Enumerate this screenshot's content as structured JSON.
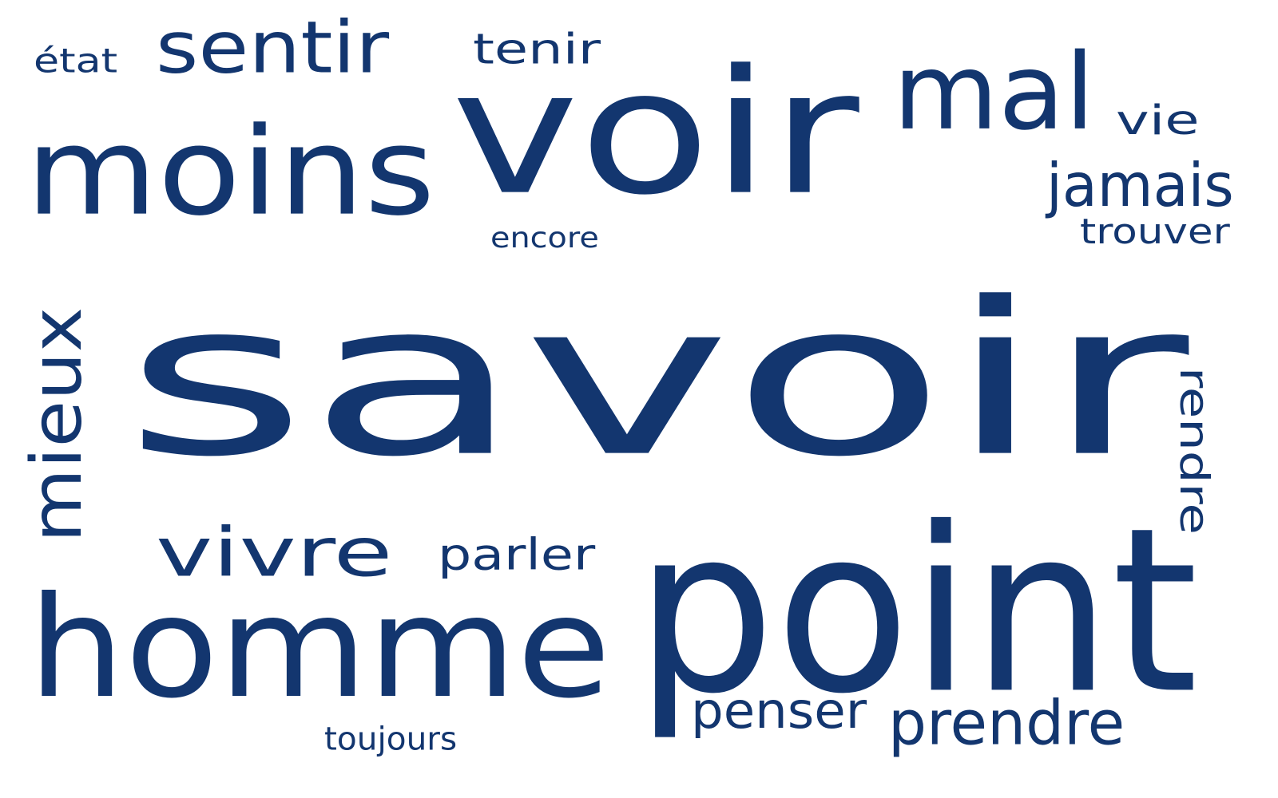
{
  "theme": {
    "background": "#ffffff",
    "word_color": "#13366f"
  },
  "words": [
    {
      "id": "savoir",
      "text": "savoir"
    },
    {
      "id": "point",
      "text": "point"
    },
    {
      "id": "voir",
      "text": "voir"
    },
    {
      "id": "homme",
      "text": "homme"
    },
    {
      "id": "moins",
      "text": "moins"
    },
    {
      "id": "mal",
      "text": "mal"
    },
    {
      "id": "mieux",
      "text": "mieux"
    },
    {
      "id": "vivre",
      "text": "vivre"
    },
    {
      "id": "sentir",
      "text": "sentir"
    },
    {
      "id": "rendre",
      "text": "rendre"
    },
    {
      "id": "prendre",
      "text": "prendre"
    },
    {
      "id": "penser",
      "text": "penser"
    },
    {
      "id": "tenir",
      "text": "tenir"
    },
    {
      "id": "parler",
      "text": "parler"
    },
    {
      "id": "jamais",
      "text": "jamais"
    },
    {
      "id": "trouver",
      "text": "trouver"
    },
    {
      "id": "vie",
      "text": "vie"
    },
    {
      "id": "etat",
      "text": "état"
    },
    {
      "id": "encore",
      "text": "encore"
    },
    {
      "id": "toujours",
      "text": "toujours"
    }
  ]
}
